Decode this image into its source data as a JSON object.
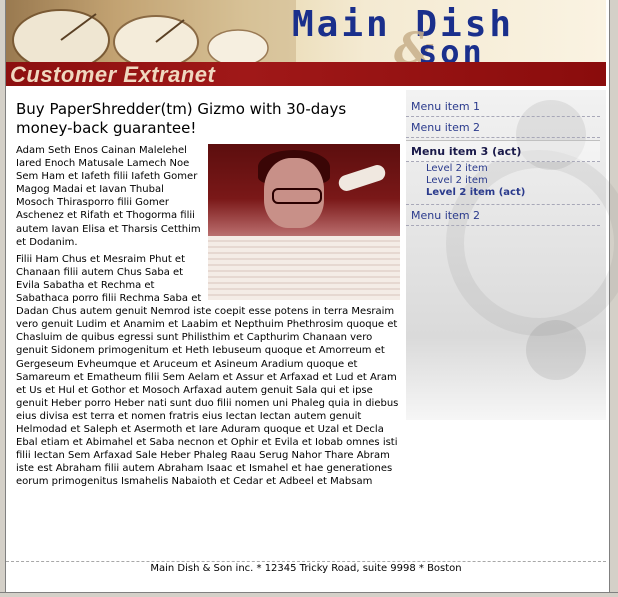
{
  "header": {
    "brand_main": "Main Dish",
    "brand_amp": "&",
    "brand_sub": "son",
    "title": "Customer Extranet"
  },
  "menu": {
    "items": [
      {
        "label": "Menu item 1",
        "active": false
      },
      {
        "label": "Menu item 2",
        "active": false
      },
      {
        "label": "Menu item 3 (act)",
        "active": true
      },
      {
        "label": "Menu item 2",
        "active": false
      }
    ],
    "sub_items": [
      {
        "label": "Level 2 item",
        "active": false
      },
      {
        "label": "Level 2 item",
        "active": false
      },
      {
        "label": "Level 2 item (act)",
        "active": true
      }
    ]
  },
  "content": {
    "headline": "Buy PaperShredder(tm) Gizmo with 30-days money-back guarantee!",
    "para1": "Adam Seth Enos Cainan Malelehel Iared Enoch Matusale Lamech Noe Sem Ham et Iafeth filii Iafeth Gomer Magog Madai et Iavan Thubal Mosoch Thirasporro filii Gomer Aschenez et Rifath et Thogorma filii autem Iavan Elisa et Tharsis Cetthim et Dodanim.",
    "para2": "Filii Ham Chus et Mesraim Phut et Chanaan filii autem Chus Saba et Evila Sabatha et Rechma et Sabathaca porro filii Rechma Saba et Dadan Chus autem genuit Nemrod iste coepit esse potens in terra Mesraim vero genuit Ludim et Anamim et Laabim et Nepthuim Phethrosim quoque et Chasluim de quibus egressi sunt Philisthim et Capthurim Chanaan vero genuit Sidonem primogenitum et Heth Iebuseum quoque et Amorreum et Gergeseum Evheumque et Aruceum et Asineum Aradium quoque et Samareum et Ematheum filii Sem Aelam et Assur et Arfaxad et Lud et Aram et Us et Hul et Gothor et Mosoch Arfaxad autem genuit Sala qui et ipse genuit Heber porro Heber nati sunt duo filii nomen uni Phaleg quia in diebus eius divisa est terra et nomen fratris eius Iectan Iectan autem genuit Helmodad et Saleph et Asermoth et Iare Aduram quoque et Uzal et Decla Ebal etiam et Abimahel et Saba necnon et Ophir et Evila et Iobab omnes isti filii Iectan Sem Arfaxad Sale Heber Phaleg Raau Serug Nahor Thare Abram iste est Abraham filii autem Abraham Isaac et Ismahel et hae generationes eorum primogenitus Ismahelis Nabaioth et Cedar et Adbeel et Mabsam"
  },
  "footer": {
    "text": "Main Dish & Son inc. * 12345 Tricky Road, suite 9998 * Boston"
  },
  "colors": {
    "brand_blue": "#1a2f8c",
    "banner_red": "#8c1010",
    "menu_link": "#2a3a8c"
  }
}
